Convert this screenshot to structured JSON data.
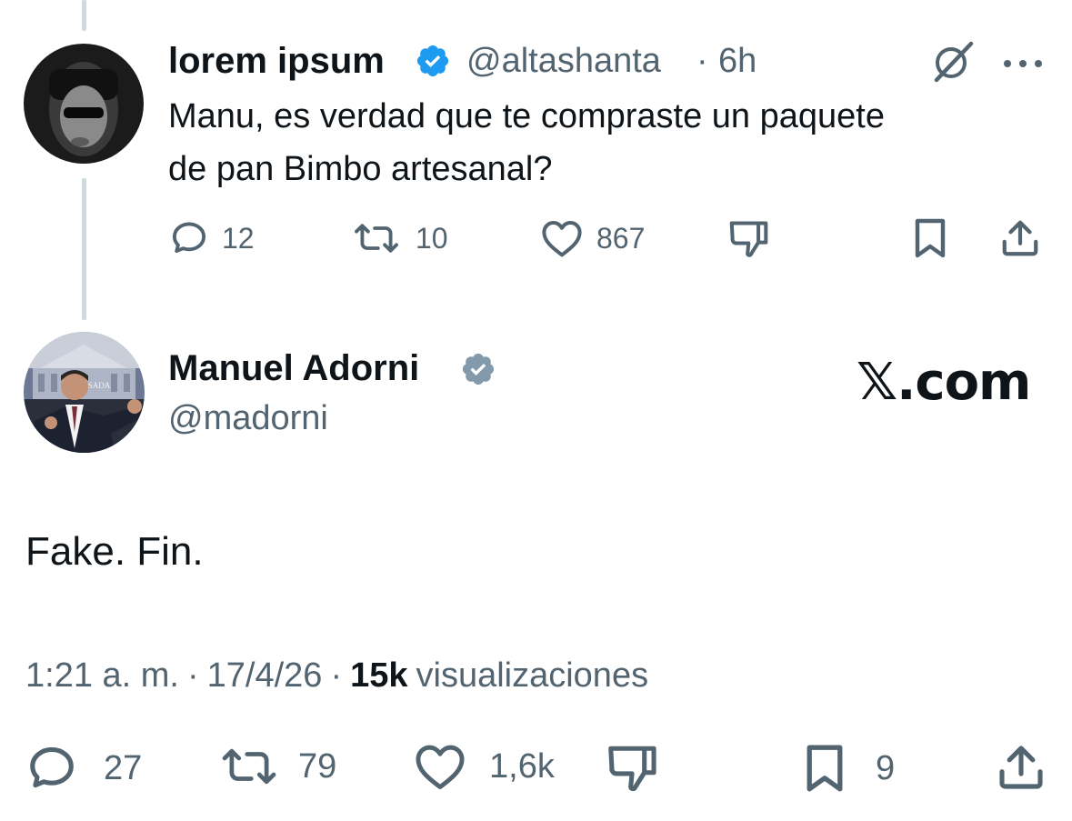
{
  "reply_tweet": {
    "author_name": "lorem ipsum",
    "handle": "@altashanta",
    "separator": "·",
    "time": "6h",
    "text_line1": "Manu, es verdad que te compraste un paquete",
    "text_line2": "de pan Bimbo artesanal?",
    "verified_color": "#1d9bf0",
    "actions": {
      "replies": "12",
      "reposts": "10",
      "likes": "867"
    }
  },
  "main_tweet": {
    "author_name": "Manuel Adorni",
    "handle": "@madorni",
    "verified_color": "#829aab",
    "watermark": "𝕏.com",
    "avatar_sign": "A ROSADA",
    "text": "Fake. Fin.",
    "time": "1:21 a. m.",
    "separator1": "·",
    "date": "17/4/26",
    "separator2": "·",
    "views_count": "15k",
    "views_label": "visualizaciones",
    "actions": {
      "replies": "27",
      "reposts": "79",
      "likes": "1,6k",
      "bookmarks": "9"
    }
  },
  "icons": [
    "grok-icon",
    "more-icon",
    "reply-icon",
    "repost-icon",
    "like-icon",
    "dislike-icon",
    "bookmark-icon",
    "share-icon",
    "verified-badge-icon"
  ],
  "colors": {
    "text": "#0f1419",
    "secondary": "#536471",
    "thread_line": "#cfd9de"
  }
}
